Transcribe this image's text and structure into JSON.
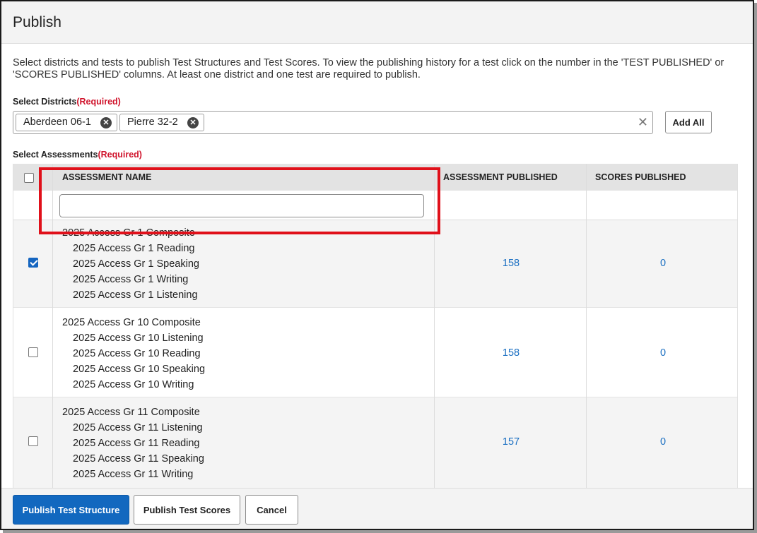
{
  "header": {
    "title": "Publish"
  },
  "description": "Select districts and tests to publish Test Structures and Test Scores. To view the publishing history for a test click on the number in the 'TEST PUBLISHED' or 'SCORES PUBLISHED' columns. At least one district and one test are required to publish.",
  "districts": {
    "label": "Select Districts",
    "required": "(Required)",
    "selected": [
      "Aberdeen 06-1",
      "Pierre 32-2"
    ],
    "clear_icon": "close-icon",
    "add_all_label": "Add All"
  },
  "assessments": {
    "label": "Select Assessments",
    "required": "(Required)",
    "columns": [
      "ASSESSMENT NAME",
      "ASSESSMENT PUBLISHED",
      "SCORES PUBLISHED"
    ],
    "filter_value": "",
    "rows": [
      {
        "checked": true,
        "composite": "2025 Access Gr 1 Composite",
        "subtests": [
          "2025 Access Gr 1 Reading",
          "2025 Access Gr 1 Speaking",
          "2025 Access Gr 1 Writing",
          "2025 Access Gr 1 Listening"
        ],
        "assessment_published": "158",
        "scores_published": "0"
      },
      {
        "checked": false,
        "composite": "2025 Access Gr 10 Composite",
        "subtests": [
          "2025 Access Gr 10 Listening",
          "2025 Access Gr 10 Reading",
          "2025 Access Gr 10 Speaking",
          "2025 Access Gr 10 Writing"
        ],
        "assessment_published": "158",
        "scores_published": "0"
      },
      {
        "checked": false,
        "composite": "2025 Access Gr 11 Composite",
        "subtests": [
          "2025 Access Gr 11 Listening",
          "2025 Access Gr 11 Reading",
          "2025 Access Gr 11 Speaking",
          "2025 Access Gr 11 Writing"
        ],
        "assessment_published": "157",
        "scores_published": "0"
      }
    ]
  },
  "footer": {
    "publish_structure_label": "Publish Test Structure",
    "publish_scores_label": "Publish Test Scores",
    "cancel_label": "Cancel"
  },
  "colors": {
    "primary": "#1268bf",
    "link": "#1a6fc2",
    "required": "#d0142c",
    "highlight": "#e0101a"
  }
}
